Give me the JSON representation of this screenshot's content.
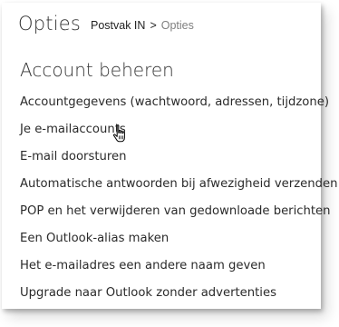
{
  "header": {
    "title": "Opties",
    "breadcrumb": {
      "parent": "Postvak IN",
      "separator": ">",
      "current": "Opties"
    }
  },
  "section": {
    "title": "Account beheren"
  },
  "menu": {
    "items": [
      {
        "label": "Accountgegevens (wachtwoord, adressen, tijdzone)"
      },
      {
        "label": "Je e-mailaccounts"
      },
      {
        "label": "E-mail doorsturen"
      },
      {
        "label": "Automatische antwoorden bij afwezigheid verzenden"
      },
      {
        "label": "POP en het verwijderen van gedownloade berichten"
      },
      {
        "label": "Een Outlook-alias maken"
      },
      {
        "label": "Het e-mailadres een andere naam geven"
      },
      {
        "label": "Upgrade naar Outlook zonder advertenties"
      }
    ]
  },
  "cursor": {
    "icon": "hand-pointer-icon"
  }
}
